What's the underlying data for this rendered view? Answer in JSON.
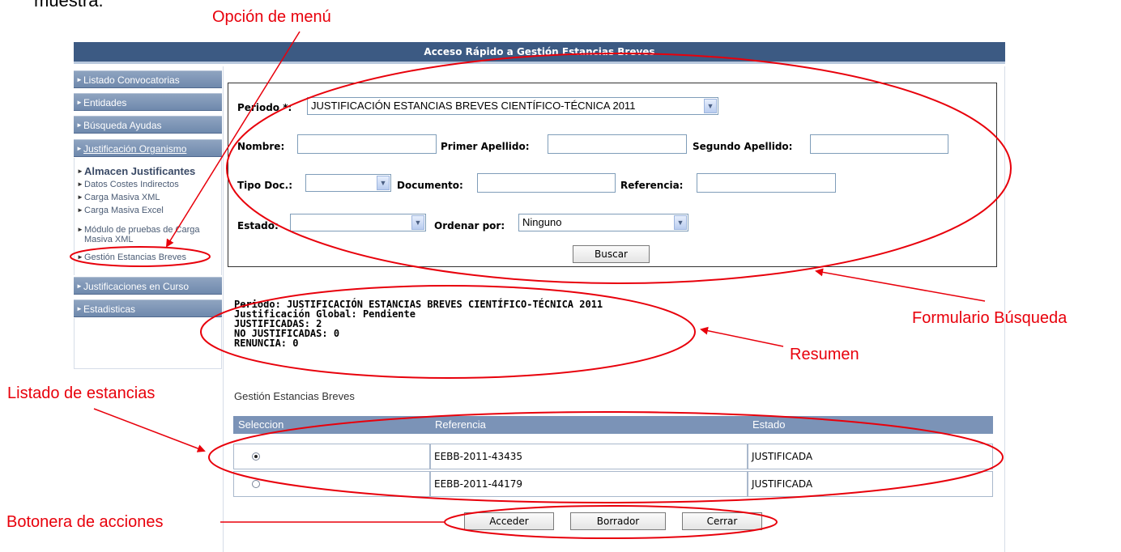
{
  "doc_fragment": "muestra.",
  "header": {
    "title": "Acceso Rápido a Gestión Estancias Breves"
  },
  "sidebar": {
    "top_items": [
      {
        "label": "Listado Convocatorias"
      },
      {
        "label": "Entidades"
      },
      {
        "label": "Búsqueda Ayudas"
      },
      {
        "label": "Justificación Organismo"
      }
    ],
    "sub_items": [
      {
        "label": "Almacen Justificantes"
      },
      {
        "label": "Datos Costes Indirectos"
      },
      {
        "label": "Carga Masiva XML"
      },
      {
        "label": "Carga Masiva Excel"
      },
      {
        "label": "Módulo de pruebas de Carga Masiva XML"
      },
      {
        "label": "Gestión Estancias Breves"
      }
    ],
    "bottom_items": [
      {
        "label": "Justificaciones en Curso"
      },
      {
        "label": "Estadisticas"
      }
    ]
  },
  "form": {
    "periodo_label": "Periodo *:",
    "periodo_value": "JUSTIFICACIÓN ESTANCIAS BREVES CIENTÍFICO-TÉCNICA 2011",
    "nombre_label": "Nombre:",
    "nombre_value": "",
    "primer_apellido_label": "Primer Apellido:",
    "primer_apellido_value": "",
    "segundo_apellido_label": "Segundo Apellido:",
    "segundo_apellido_value": "",
    "tipo_doc_label": "Tipo Doc.:",
    "tipo_doc_value": "",
    "documento_label": "Documento:",
    "documento_value": "",
    "referencia_label": "Referencia:",
    "referencia_value": "",
    "estado_label": "Estado:",
    "estado_value": "",
    "ordenar_label": "Ordenar por:",
    "ordenar_value": "Ninguno",
    "buscar_label": "Buscar"
  },
  "summary": {
    "line1": "Periodo: JUSTIFICACIÓN ESTANCIAS BREVES CIENTÍFICO-TÉCNICA 2011",
    "line2": "Justificación Global: Pendiente",
    "line3": "JUSTIFICADAS: 2",
    "line4": "NO JUSTIFICADAS: 0",
    "line5": "RENUNCIA: 0"
  },
  "list": {
    "title": "Gestión Estancias Breves",
    "columns": [
      "Seleccion",
      "Referencia",
      "Estado"
    ],
    "rows": [
      {
        "referencia": "EEBB-2011-43435",
        "estado": "JUSTIFICADA",
        "selected": true
      },
      {
        "referencia": "EEBB-2011-44179",
        "estado": "JUSTIFICADA",
        "selected": false
      }
    ]
  },
  "actions": {
    "acceder": "Acceder",
    "borrador": "Borrador",
    "cerrar": "Cerrar"
  },
  "annotations": {
    "opcion_menu": "Opción de menú",
    "formulario": "Formulario Búsqueda",
    "resumen": "Resumen",
    "listado": "Listado de estancias",
    "botonera": "Botonera de acciones"
  },
  "colors": {
    "header": "#3c5a83",
    "sidebar_button": "#7f96b6",
    "table_header": "#7b93b7",
    "annotation": "#e8000b"
  }
}
